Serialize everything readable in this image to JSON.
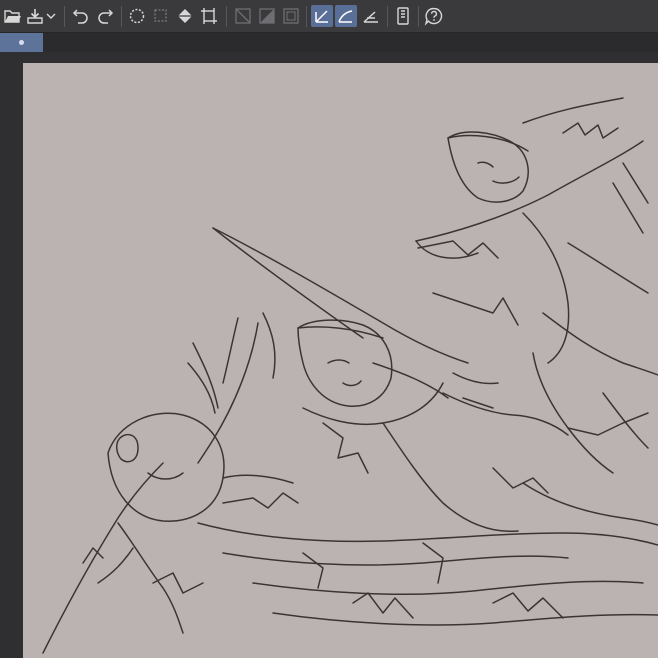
{
  "toolbar": {
    "groups": [
      [
        "open-file-icon",
        "save-file-icon",
        "dropdown-chevron-icon"
      ],
      [
        "undo-icon",
        "redo-icon"
      ],
      [
        "lasso-selection-icon",
        "select-all-icon",
        "fill-icon",
        "crop-icon"
      ],
      [
        "layer-clear-icon",
        "layer-mask-icon",
        "frame-icon"
      ],
      [
        "ruler-straight-icon",
        "ruler-curve-icon",
        "ruler-angle-icon"
      ],
      [
        "device-icon"
      ],
      [
        "help-icon"
      ]
    ],
    "active_tools": [
      "ruler-straight-icon",
      "ruler-curve-icon"
    ]
  },
  "tab": {
    "active": true
  },
  "canvas": {
    "background": "#bbb3b2",
    "line_color": "#3a3535"
  },
  "colors": {
    "toolbar_bg": "#3a3a3d",
    "accent": "#5d7399",
    "workspace_bg": "#2f2f31"
  }
}
